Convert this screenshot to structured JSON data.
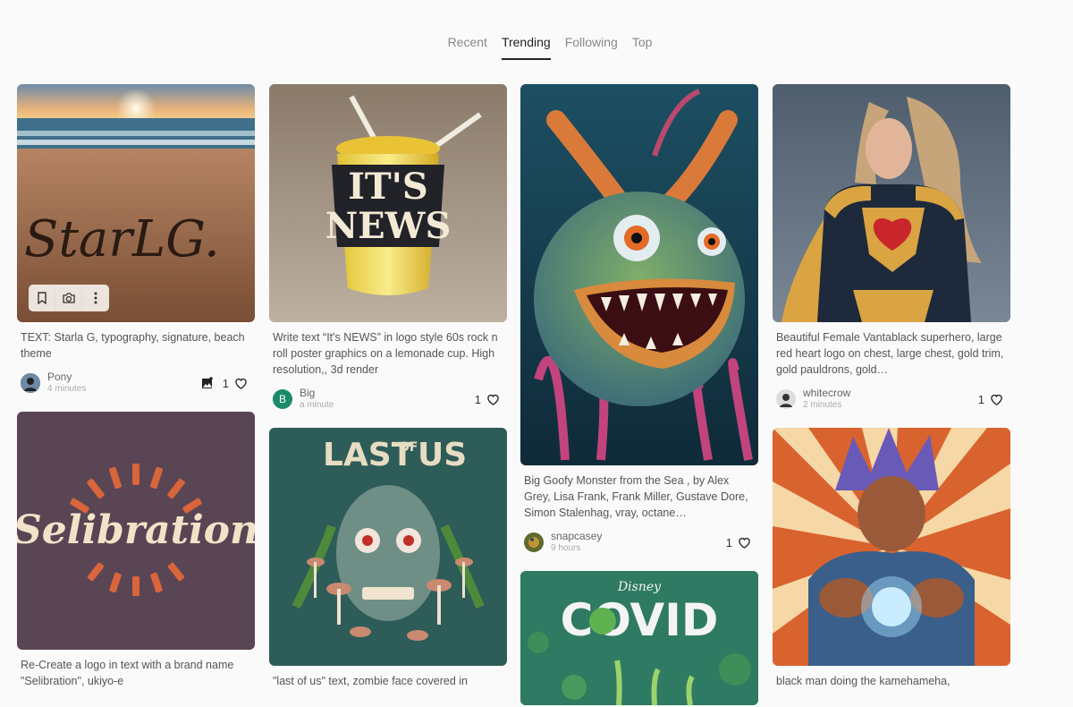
{
  "tabs": [
    {
      "label": "Recent"
    },
    {
      "label": "Trending",
      "active": true
    },
    {
      "label": "Following"
    },
    {
      "label": "Top"
    }
  ],
  "cards": {
    "starla": {
      "caption": "TEXT: Starla G, typography, signature, beach theme",
      "user": "Pony",
      "time": "4 minutes",
      "likes": "1",
      "image_text": "StarLG."
    },
    "news": {
      "caption": "Write text “It's NEWS” in logo style 60s rock n roll poster graphics on a lemonade cup. High resolution,, 3d render",
      "user": "Big",
      "avatar_letter": "B",
      "time": "a minute",
      "likes": "1",
      "image_text_1": "IT'S",
      "image_text_2": "NEWS"
    },
    "monster": {
      "caption": "Big Goofy Monster from the Sea , by Alex Grey, Lisa Frank, Frank Miller, Gustave Dore, Simon Stalenhag, vray, octane…",
      "user": "snapcasey",
      "time": "9 hours",
      "likes": "1"
    },
    "hero": {
      "caption": "Beautiful Female Vantablack superhero, large red heart logo on chest, large chest, gold trim, gold pauldrons, gold…",
      "user": "whitecrow",
      "time": "2 minutes",
      "likes": "1"
    },
    "selibration": {
      "caption": "Re-Create a logo in text with a brand name \"Selibration\", ukiyo-e",
      "image_text": "Selibration"
    },
    "lastofus": {
      "caption": "\"last of us\" text, zombie face covered in",
      "image_text_1": "LAST",
      "image_text_2": "OF",
      "image_text_3": "US"
    },
    "covid": {
      "image_text_1": "Disney",
      "image_text_2": "COVID"
    },
    "kame": {
      "caption": "black man doing the kamehameha,"
    }
  },
  "colors": {
    "accent": "#222222",
    "avatar_big": "#1a8a6a"
  }
}
